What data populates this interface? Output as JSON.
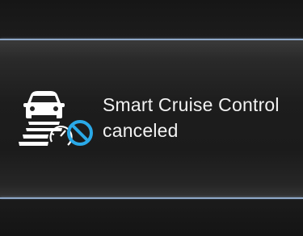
{
  "notification": {
    "title_line1": "Smart Cruise Control",
    "title_line2": "canceled",
    "icon": "smart-cruise-canceled-icon"
  },
  "colors": {
    "separator": "#8fa8c8",
    "text": "#f2f2f2",
    "icon_white": "#ffffff",
    "cancel_blue": "#2aa9e8"
  }
}
